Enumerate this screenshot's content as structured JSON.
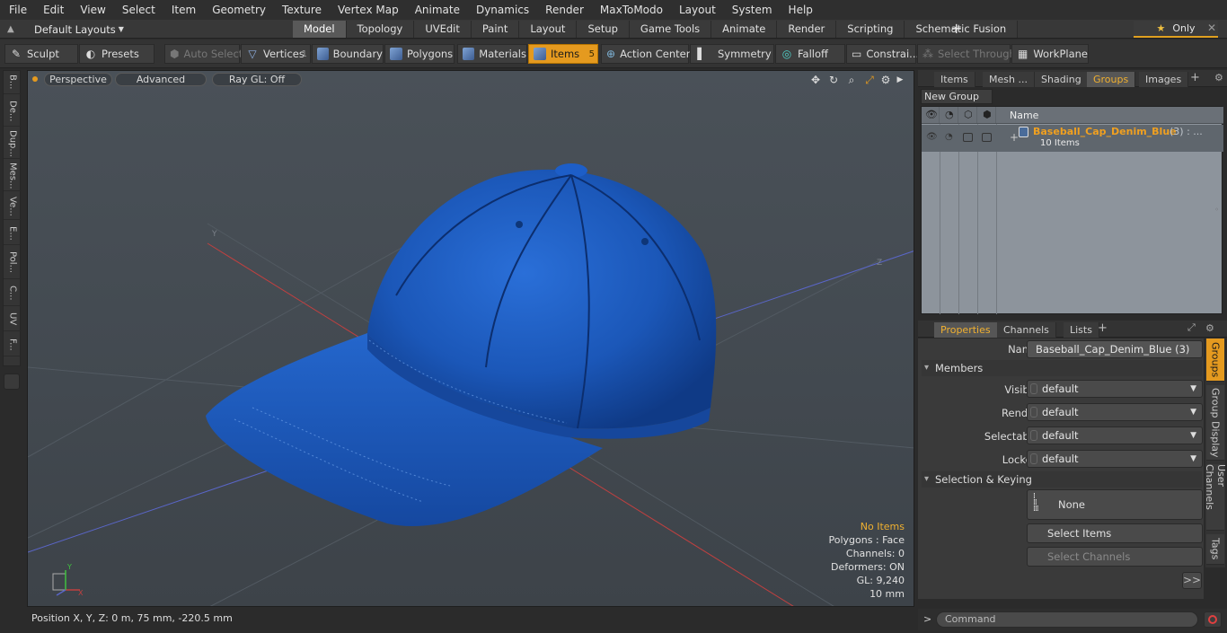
{
  "menu": [
    "File",
    "Edit",
    "View",
    "Select",
    "Item",
    "Geometry",
    "Texture",
    "Vertex Map",
    "Animate",
    "Dynamics",
    "Render",
    "MaxToModo",
    "Layout",
    "System",
    "Help"
  ],
  "layout_selector": "Default Layouts",
  "top_tabs": [
    {
      "label": "Model",
      "active": true
    },
    {
      "label": "Topology",
      "active": false
    },
    {
      "label": "UVEdit",
      "active": false
    },
    {
      "label": "Paint",
      "active": false
    },
    {
      "label": "Layout",
      "active": false
    },
    {
      "label": "Setup",
      "active": false
    },
    {
      "label": "Game Tools",
      "active": false
    },
    {
      "label": "Animate",
      "active": false
    },
    {
      "label": "Render",
      "active": false
    },
    {
      "label": "Scripting",
      "active": false
    },
    {
      "label": "Schematic Fusion",
      "active": false
    }
  ],
  "only_label": "Only",
  "toolbar": {
    "sculpt": "Sculpt",
    "presets": "Presets",
    "auto_select": "Auto Select",
    "vertices": "Vertices",
    "vertices_count": "1",
    "boundary": "Boundary",
    "polygons": "Polygons",
    "materials": "Materials",
    "items": "Items",
    "items_count": "5",
    "action_center": "Action Center",
    "symmetry": "Symmetry",
    "falloff": "Falloff",
    "constraints": "Constrai...",
    "select_through": "Select Through",
    "workplane": "WorkPlane"
  },
  "left_tabs": [
    "B...",
    "De...",
    "Dup...",
    "Mes...",
    "Ve...",
    "E...",
    "Pol...",
    "C...",
    "UV",
    "F..."
  ],
  "viewport": {
    "view_mode": "Perspective",
    "shading": "Advanced",
    "raygl": "Ray GL: Off",
    "info": {
      "items": "No Items",
      "polygons": "Polygons : Face",
      "channels": "Channels: 0",
      "deformers": "Deformers: ON",
      "gl": "GL: 9,240",
      "scale": "10 mm"
    },
    "axis": {
      "y": "Y",
      "x": "X",
      "z": "Z"
    }
  },
  "status": "Position X, Y, Z:   0 m, 75 mm, -220.5 mm",
  "right_tabs": [
    {
      "label": "Items",
      "active": false
    },
    {
      "label": "Mesh ...",
      "active": false
    },
    {
      "label": "Shading",
      "active": false
    },
    {
      "label": "Groups",
      "active": true
    },
    {
      "label": "Images",
      "active": false
    }
  ],
  "groups": {
    "new_group": "New Group",
    "col_name": "Name",
    "row_name": "Baseball_Cap_Denim_Blue",
    "row_count": "(3) : ...",
    "row_sub": "10 Items"
  },
  "props_tabs": [
    {
      "label": "Properties",
      "active": true
    },
    {
      "label": "Channels",
      "active": false
    },
    {
      "label": "Lists",
      "active": false
    }
  ],
  "properties": {
    "name_label": "Name",
    "name_value": "Baseball_Cap_Denim_Blue (3)",
    "members": "Members",
    "visible_label": "Visible",
    "visible_value": "default",
    "render_label": "Render",
    "render_value": "default",
    "selectable_label": "Selectable",
    "selectable_value": "default",
    "locked_label": "Locked",
    "locked_value": "default",
    "sel_keying": "Selection & Keying",
    "none": "None",
    "select_items": "Select Items",
    "select_channels": "Select Channels",
    "more": ">>"
  },
  "right_vtabs": [
    {
      "label": "Groups",
      "active": true
    },
    {
      "label": "Group Display",
      "active": false
    },
    {
      "label": "User Channels",
      "active": false
    },
    {
      "label": "Tags",
      "active": false
    }
  ],
  "command": {
    "prompt": ">",
    "placeholder": "Command"
  },
  "colors": {
    "accent": "#e59a1f",
    "cap": "#1d5ec8",
    "name_orange": "#f0a020"
  }
}
